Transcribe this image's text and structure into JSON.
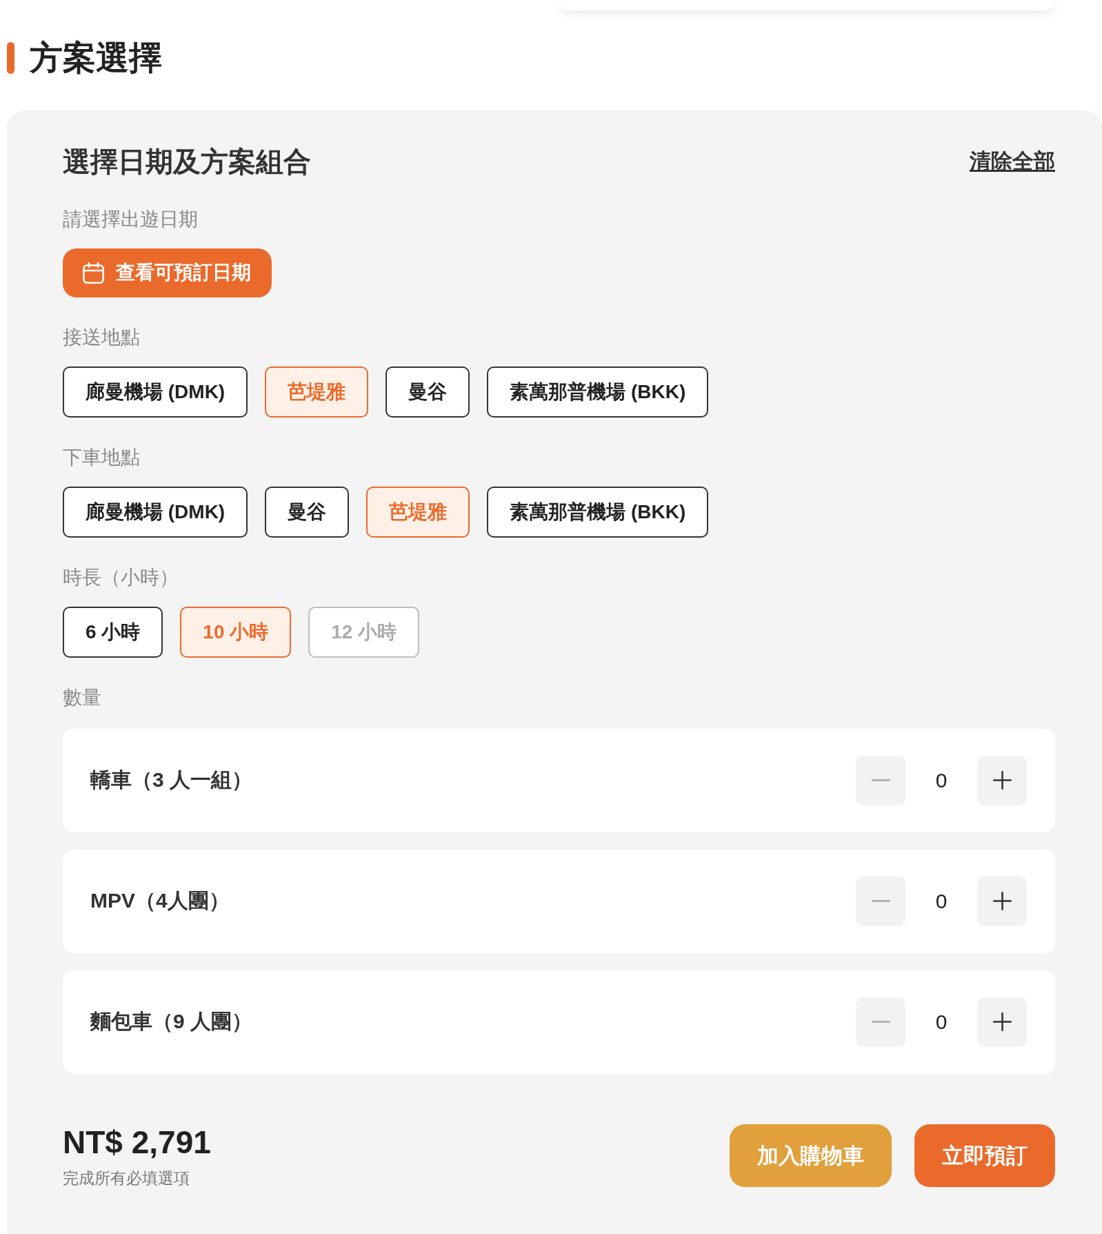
{
  "section_header": {
    "title": "方案選擇"
  },
  "panel": {
    "title": "選擇日期及方案組合",
    "clear_link": "清除全部",
    "date": {
      "label": "請選擇出遊日期",
      "button": "查看可預訂日期"
    },
    "option_groups": [
      {
        "label": "接送地點",
        "options": [
          {
            "label": "廊曼機場 (DMK)",
            "selected": false,
            "disabled": false
          },
          {
            "label": "芭堤雅",
            "selected": true,
            "disabled": false
          },
          {
            "label": "曼谷",
            "selected": false,
            "disabled": false
          },
          {
            "label": "素萬那普機場 (BKK)",
            "selected": false,
            "disabled": false
          }
        ]
      },
      {
        "label": "下車地點",
        "options": [
          {
            "label": "廊曼機場 (DMK)",
            "selected": false,
            "disabled": false
          },
          {
            "label": "曼谷",
            "selected": false,
            "disabled": false
          },
          {
            "label": "芭堤雅",
            "selected": true,
            "disabled": false
          },
          {
            "label": "素萬那普機場 (BKK)",
            "selected": false,
            "disabled": false
          }
        ]
      },
      {
        "label": "時長（小時）",
        "options": [
          {
            "label": "6 小時",
            "selected": false,
            "disabled": false
          },
          {
            "label": "10 小時",
            "selected": true,
            "disabled": false
          },
          {
            "label": "12 小時",
            "selected": false,
            "disabled": true
          }
        ]
      }
    ],
    "quantity": {
      "label": "數量",
      "items": [
        {
          "name": "轎車（3 人一組）",
          "value": "0",
          "decrement_disabled": true
        },
        {
          "name": "MPV（4人團）",
          "value": "0",
          "decrement_disabled": true
        },
        {
          "name": "麵包車（9 人團）",
          "value": "0",
          "decrement_disabled": true
        }
      ]
    },
    "footer": {
      "price": "NT$ 2,791",
      "note": "完成所有必填選項",
      "buttons": [
        {
          "label": "加入購物車",
          "kind": "secondary"
        },
        {
          "label": "立即預訂",
          "kind": "primary"
        }
      ]
    }
  }
}
